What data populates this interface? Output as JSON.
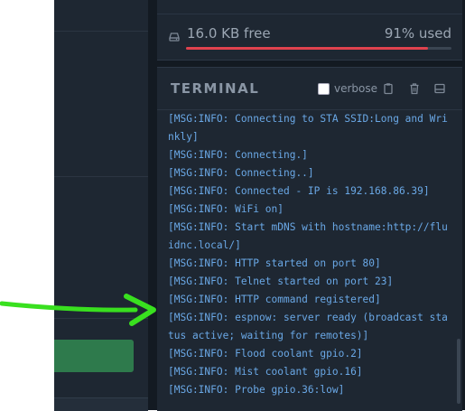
{
  "storage": {
    "free_label": "16.0 KB free",
    "used_label": "91% used",
    "used_fraction": 0.91,
    "bar_color": "#e0424e"
  },
  "terminal": {
    "title": "TERMINAL",
    "verbose_label": "verbose",
    "header_icons": [
      "clipboard-icon",
      "trash-icon",
      "minimize-icon"
    ],
    "lines": [
      "[MSG:INFO: Connecting to STA SSID:Long and Wri",
      "nkly]",
      "[MSG:INFO: Connecting.]",
      "[MSG:INFO: Connecting..]",
      "[MSG:INFO: Connected - IP is 192.168.86.39]",
      "[MSG:INFO: WiFi on]",
      "[MSG:INFO: Start mDNS with hostname:http://flu",
      "idnc.local/]",
      "[MSG:INFO: HTTP started on port 80]",
      "[MSG:INFO: Telnet started on port 23]",
      "[MSG:INFO: HTTP command registered]",
      "[MSG:INFO: espnow: server ready (broadcast sta",
      "tus active; waiting for remotes)]",
      "[MSG:INFO: Flood coolant gpio.2]",
      "[MSG:INFO: Mist coolant gpio.16]",
      "[MSG:INFO: Probe gpio.36:low]"
    ]
  },
  "annotation": {
    "icon": "arrow-right-icon",
    "color": "#39e01f"
  }
}
